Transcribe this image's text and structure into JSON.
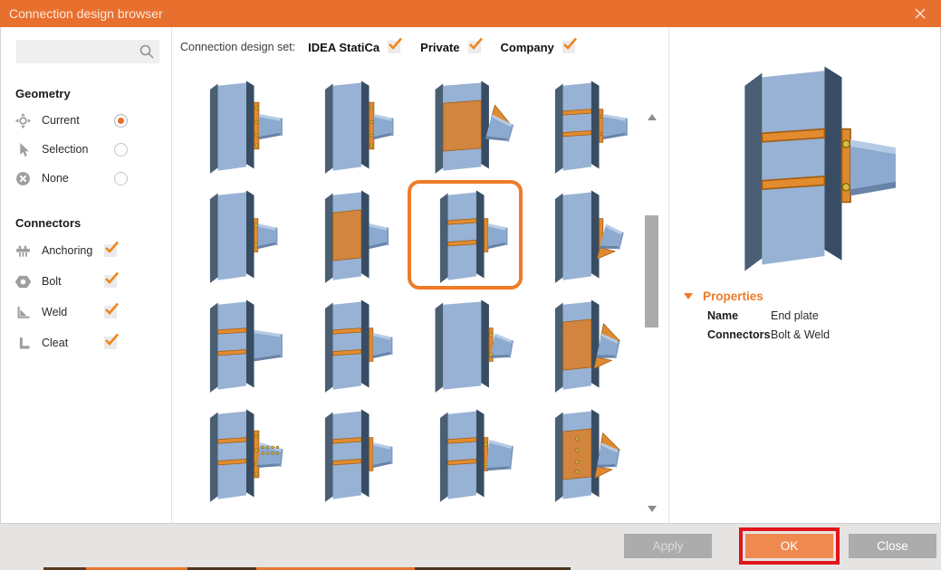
{
  "window": {
    "title": "Connection design browser"
  },
  "palette": {
    "titlebar": "#E8702E",
    "selection_border": "#EF7B28",
    "check_orange": "#F0861C",
    "ok_button": "#EE8A4F",
    "button_grey": "#ACACAC",
    "highlight_red": "#E1151B",
    "steel_light": "#97B2D4",
    "steel_dark": "#3A4E63",
    "plate_orange": "#DE8A31"
  },
  "sidebar": {
    "search": {
      "placeholder": "",
      "icon": "search-icon"
    },
    "geometry": {
      "heading": "Geometry",
      "options": [
        {
          "label": "Current",
          "icon": "target-icon",
          "selected": true
        },
        {
          "label": "Selection",
          "icon": "cursor-icon",
          "selected": false
        },
        {
          "label": "None",
          "icon": "none-icon",
          "selected": false
        }
      ]
    },
    "connectors": {
      "heading": "Connectors",
      "items": [
        {
          "label": "Anchoring",
          "icon": "anchoring-icon",
          "checked": true
        },
        {
          "label": "Bolt",
          "icon": "bolt-icon",
          "checked": true
        },
        {
          "label": "Weld",
          "icon": "weld-icon",
          "checked": true
        },
        {
          "label": "Cleat",
          "icon": "cleat-icon",
          "checked": true
        }
      ]
    }
  },
  "main": {
    "design_set_label": "Connection design set:",
    "sets": [
      {
        "label": "IDEA StatiCa",
        "checked": true
      },
      {
        "label": "Private",
        "checked": true
      },
      {
        "label": "Company",
        "checked": true
      }
    ],
    "thumbnails": [
      {
        "plate": "tall-bolted",
        "len": "long"
      },
      {
        "plate": "tall-bolted",
        "len": "short"
      },
      {
        "wide": true,
        "plate": "web",
        "drop": 16,
        "len": "long",
        "haunchTop": true
      },
      {
        "stiff": true,
        "plate": "small",
        "len": "long",
        "wings": true
      },
      {
        "plate": "small-bolted",
        "len": "short"
      },
      {
        "plate": "web",
        "len": "short"
      },
      {
        "stiff": true,
        "plate": "small",
        "len": "short",
        "selected": true
      },
      {
        "plate": "small",
        "len": "short",
        "drop": 14,
        "haunch": true
      },
      {
        "stiff": true,
        "len": "long",
        "beamBig": true
      },
      {
        "stiff": true,
        "plate": "small",
        "len": "short"
      },
      {
        "wide": true,
        "plate": "small-bolted",
        "drop": 10,
        "len": "long"
      },
      {
        "stiff": true,
        "plate": "web",
        "drop": 12,
        "haunchTop": true,
        "haunch": true
      },
      {
        "stiff": true,
        "plate": "tall-bolted",
        "boltGrid": true,
        "len": "long",
        "drop": 6
      },
      {
        "stiff": true,
        "plate": "small",
        "len": "short"
      },
      {
        "stiff": true,
        "plate": "small-bolted",
        "len": "long",
        "drop": 6,
        "beamBig": true
      },
      {
        "stiff": true,
        "plate": "web-bolted",
        "drop": 10,
        "haunchTop": true,
        "haunch": true
      }
    ]
  },
  "preview": {
    "figure": {
      "stiff": true,
      "plate": "small-bolted",
      "len": "long"
    },
    "properties_heading": "Properties",
    "fields": [
      {
        "label": "Name",
        "value": "End plate"
      },
      {
        "label": "Connectors",
        "value": "Bolt & Weld"
      }
    ]
  },
  "footer": {
    "buttons": [
      {
        "label": "Apply",
        "state": "disabled"
      },
      {
        "label": "OK",
        "state": "primary",
        "highlighted": true
      },
      {
        "label": "Close",
        "state": "normal"
      }
    ]
  }
}
